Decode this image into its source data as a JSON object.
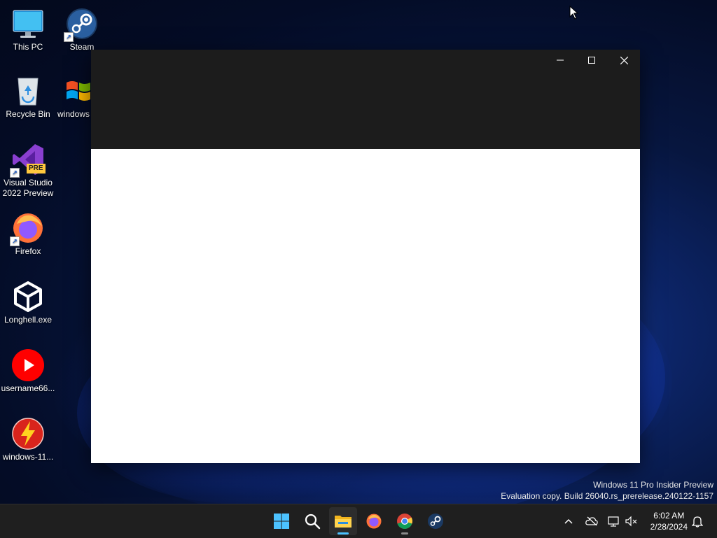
{
  "desktop": {
    "icons": [
      {
        "label": "This PC",
        "icon": "monitor-icon"
      },
      {
        "label": "Steam",
        "icon": "steam-icon"
      },
      {
        "label": "Recycle Bin",
        "icon": "recycle-bin-icon"
      },
      {
        "label": "windows",
        "icon": "windows-logo-icon"
      },
      {
        "label": "Visual Studio 2022 Preview",
        "icon": "visual-studio-icon",
        "badge": "PRE"
      },
      {
        "label": "Firefox",
        "icon": "firefox-icon"
      },
      {
        "label": "Longhell.exe",
        "icon": "unity-icon"
      },
      {
        "label": "username66...",
        "icon": "youtube-icon"
      },
      {
        "label": "windows-11...",
        "icon": "flash-icon"
      }
    ]
  },
  "window": {
    "title": "",
    "controls": {
      "minimize": "minimize",
      "maximize": "maximize",
      "close": "close"
    }
  },
  "watermark": {
    "line1": "Windows 11 Pro Insider Preview",
    "line2": "Evaluation copy. Build 26040.rs_prerelease.240122-1157"
  },
  "taskbar": {
    "apps": [
      {
        "name": "Start",
        "icon": "windows-start-icon"
      },
      {
        "name": "Search",
        "icon": "search-icon"
      },
      {
        "name": "File Explorer",
        "icon": "file-explorer-icon",
        "active": true
      },
      {
        "name": "Firefox",
        "icon": "firefox-icon"
      },
      {
        "name": "Chrome",
        "icon": "chrome-icon",
        "running": true
      },
      {
        "name": "Steam",
        "icon": "steam-icon"
      }
    ],
    "tray": [
      "chevron-up-icon",
      "onedrive-icon",
      "network-icon",
      "volume-muted-icon"
    ],
    "clock": {
      "time": "6:02 AM",
      "date": "2/28/2024"
    },
    "notifications": "bell-icon"
  },
  "colors": {
    "titlebar": "#1c1c1c",
    "taskbar": "#1f1f1f",
    "accent": "#4cc2ff",
    "wallpaper": "#0c2466"
  }
}
